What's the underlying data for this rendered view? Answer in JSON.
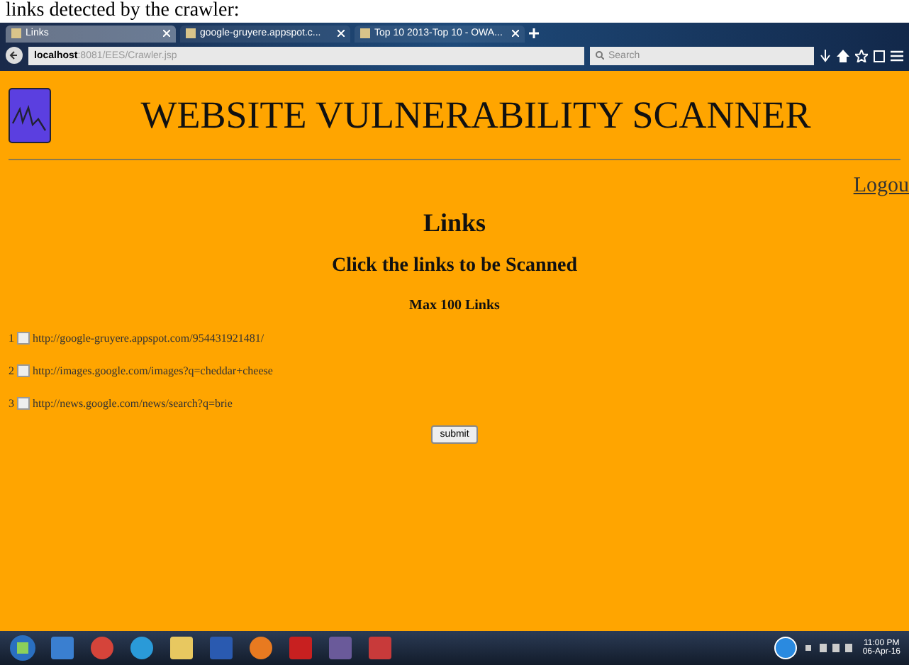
{
  "caption": "links detected by the crawler:",
  "browser": {
    "tabs": [
      {
        "label": "Links",
        "selected": true
      },
      {
        "label": "google-gruyere.appspot.c...",
        "selected": false
      },
      {
        "label": "Top 10 2013-Top 10 - OWA...",
        "selected": false
      }
    ],
    "address": {
      "host": "localhost",
      "path": ":8081/EES/Crawler.jsp"
    },
    "search": {
      "placeholder": "Search"
    }
  },
  "page": {
    "title": "WEBSITE VULNERABILITY SCANNER",
    "logout": "Logou",
    "heading": "Links",
    "subheading": "Click the links to be Scanned",
    "limit": "Max 100 Links",
    "links": [
      {
        "index": "1",
        "url": "http://google-gruyere.appspot.com/954431921481/",
        "checked": false
      },
      {
        "index": "2",
        "url": "http://images.google.com/images?q=cheddar+cheese",
        "checked": false
      },
      {
        "index": "3",
        "url": "http://news.google.com/news/search?q=brie",
        "checked": false
      }
    ],
    "submit": "submit"
  },
  "taskbar": {
    "time": "11:00 PM",
    "date": "06-Apr-16"
  }
}
